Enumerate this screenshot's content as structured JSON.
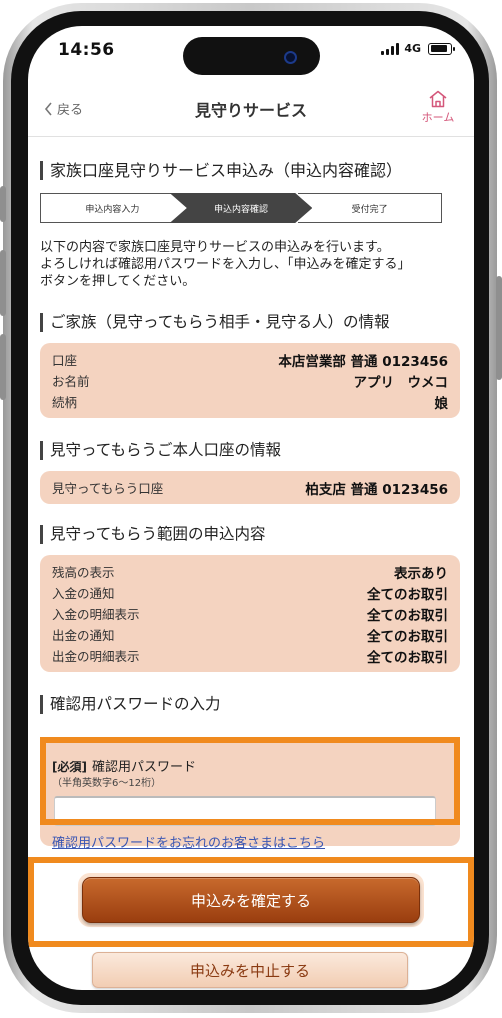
{
  "status_bar": {
    "time": "14:56",
    "network": "4G"
  },
  "nav": {
    "back_label": "戻る",
    "title": "見守りサービス",
    "home_label": "ホーム"
  },
  "page": {
    "title": "家族口座見守りサービス申込み（申込内容確認）"
  },
  "steps": [
    "申込内容入力",
    "申込内容確認",
    "受付完了"
  ],
  "current_step": 2,
  "intro": {
    "line1": "以下の内容で家族口座見守りサービスの申込みを行います。",
    "line2": "よろしければ確認用パスワードを入力し、「申込みを確定する」",
    "line3": "ボタンを押してください。"
  },
  "family_section": {
    "title": "ご家族（見守ってもらう相手・見守る人）の情報",
    "rows": [
      {
        "label": "口座",
        "value": "本店営業部 普通 0123456"
      },
      {
        "label": "お名前",
        "value": "アプリ　ウメコ"
      },
      {
        "label": "続柄",
        "value": "娘"
      }
    ]
  },
  "self_section": {
    "title": "見守ってもらうご本人口座の情報",
    "rows": [
      {
        "label": "見守ってもらう口座",
        "value": "柏支店 普通 0123456"
      }
    ]
  },
  "scope_section": {
    "title": "見守ってもらう範囲の申込内容",
    "rows": [
      {
        "label": "残高の表示",
        "value": "表示あり"
      },
      {
        "label": "入金の通知",
        "value": "全てのお取引"
      },
      {
        "label": "入金の明細表示",
        "value": "全てのお取引"
      },
      {
        "label": "出金の通知",
        "value": "全てのお取引"
      },
      {
        "label": "出金の明細表示",
        "value": "全てのお取引"
      }
    ]
  },
  "password_section": {
    "title": "確認用パスワードの入力",
    "required_tag": "[必須]",
    "field_label": "確認用パスワード",
    "field_note": "（半角英数字6～12桁）",
    "value": "",
    "forgot_link": "確認用パスワードをお忘れのお客さまはこちら"
  },
  "buttons": {
    "confirm": "申込みを確定する",
    "cancel": "申込みを中止する"
  },
  "colors": {
    "card_bg": "#f4d3c0",
    "accent": "#9a3e0f",
    "highlight": "#f08a1e",
    "link": "#3a56b3",
    "home": "#d4577a"
  }
}
